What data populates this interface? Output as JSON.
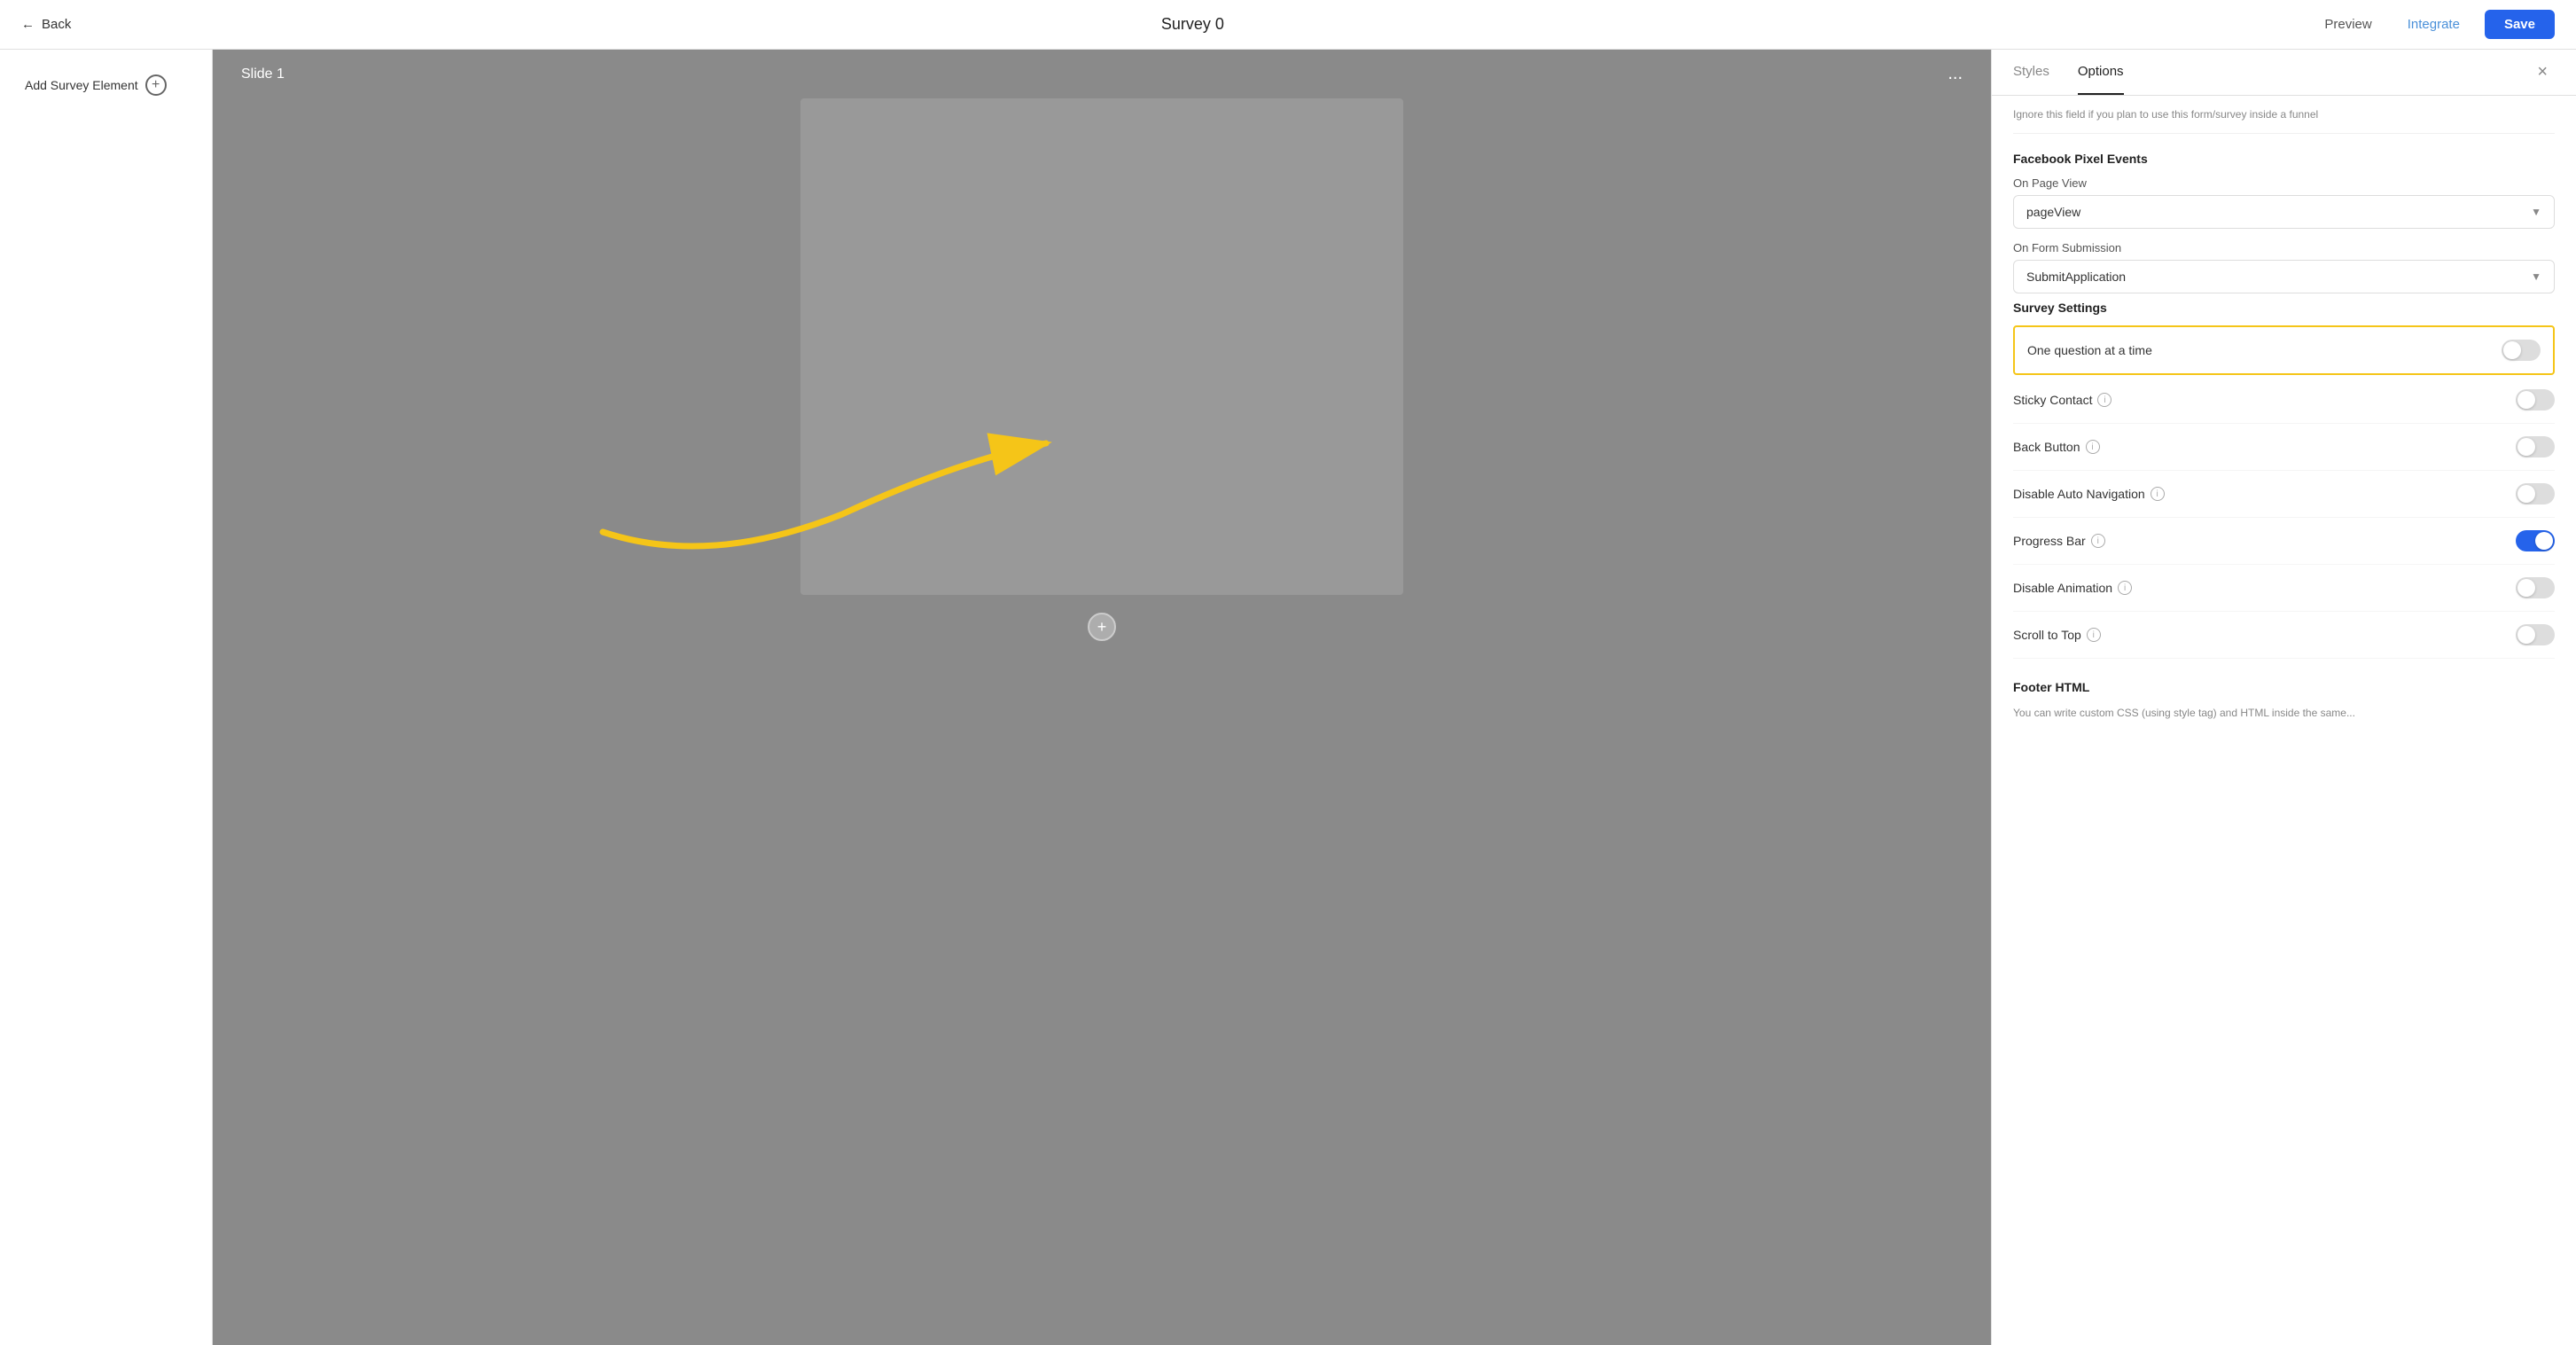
{
  "header": {
    "back_label": "Back",
    "title": "Survey 0",
    "preview_label": "Preview",
    "integrate_label": "Integrate",
    "save_label": "Save"
  },
  "sidebar": {
    "add_element_label": "Add Survey Element",
    "plus_icon": "+"
  },
  "slide": {
    "title": "Slide 1",
    "dots": "..."
  },
  "add_slide_icon": "+",
  "right_panel": {
    "close_icon": "×",
    "tabs": [
      {
        "label": "Styles",
        "active": false
      },
      {
        "label": "Options",
        "active": true
      }
    ],
    "info_text": "Ignore this field if you plan to use this form/survey inside a funnel",
    "facebook_pixel_events": {
      "title": "Facebook Pixel Events",
      "on_page_view": {
        "label": "On Page View",
        "value": "pageView"
      },
      "on_form_submission": {
        "label": "On Form Submission",
        "value": "SubmitApplication"
      }
    },
    "survey_settings": {
      "title": "Survey Settings",
      "toggles": [
        {
          "label": "One question at a time",
          "has_info": false,
          "state": "off",
          "highlighted": true
        },
        {
          "label": "Sticky Contact",
          "has_info": true,
          "state": "off",
          "highlighted": false
        },
        {
          "label": "Back Button",
          "has_info": true,
          "state": "off",
          "highlighted": false
        },
        {
          "label": "Disable Auto Navigation",
          "has_info": true,
          "state": "off",
          "highlighted": false
        },
        {
          "label": "Progress Bar",
          "has_info": true,
          "state": "on",
          "highlighted": false
        },
        {
          "label": "Disable Animation",
          "has_info": true,
          "state": "off",
          "highlighted": false
        },
        {
          "label": "Scroll to Top",
          "has_info": true,
          "state": "off",
          "highlighted": false
        }
      ]
    },
    "footer_html": {
      "title": "Footer HTML",
      "description": "You can write custom CSS (using style tag) and HTML inside the same..."
    }
  }
}
